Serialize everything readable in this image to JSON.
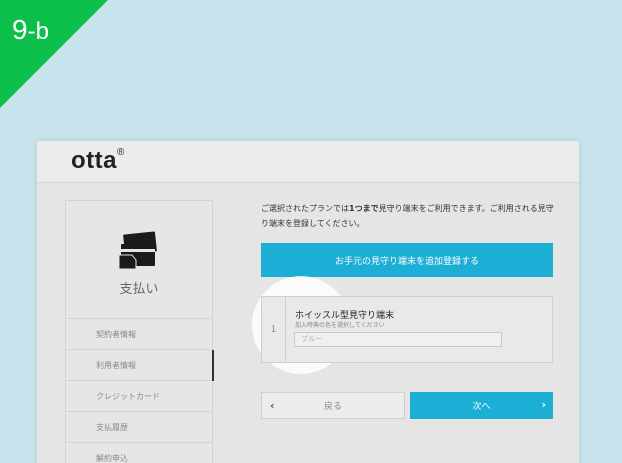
{
  "step_label": {
    "number": "9",
    "suffix": "-b"
  },
  "brand": {
    "logo": "otta",
    "mark": "®"
  },
  "sidebar": {
    "section_title": "支払い",
    "items": [
      {
        "label": "契約者情報"
      },
      {
        "label": "利用者情報"
      },
      {
        "label": "クレジットカード"
      },
      {
        "label": "支払履歴"
      },
      {
        "label": "解約申込"
      }
    ]
  },
  "main": {
    "notice_part1": "ご選択されたプランでは",
    "notice_bold": "1つまで",
    "notice_part2": "見守り端末をご利用できます。ご利用される見守り端末を登録してください。",
    "add_button": "お手元の見守り端末を追加登録する",
    "device": {
      "index": "1",
      "title": "ホイッスル型見守り端末",
      "subtitle": "加入時典の色を選択してください",
      "color_value": "ブルー"
    },
    "back_button": "戻る",
    "next_button": "次へ"
  },
  "colors": {
    "background": "#c9e3ec",
    "accent": "#1daed6",
    "step_badge": "#0bbf4a"
  },
  "icons": {
    "sidebar": "card-payment-icon",
    "back": "chevron-left-icon",
    "next": "chevron-right-icon"
  }
}
